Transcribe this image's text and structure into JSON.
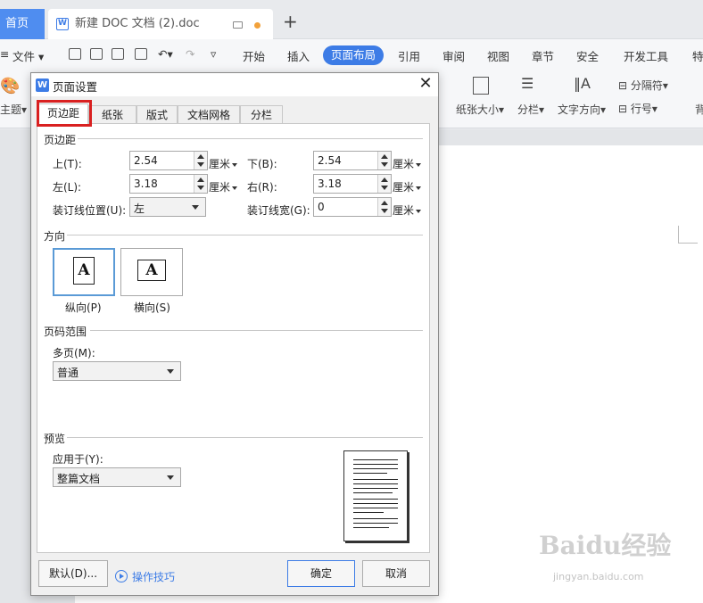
{
  "window": {
    "home_tab": "首页",
    "doc_tab": "新建 DOC 文档 (2).doc",
    "add_tab": "+"
  },
  "ribbon": {
    "file_menu": "文件",
    "tabs": [
      "开始",
      "插入",
      "页面布局",
      "引用",
      "审阅",
      "视图",
      "章节",
      "安全",
      "开发工具",
      "特"
    ],
    "active_tab": "页面布局",
    "theme_label": "主题",
    "paper_size": "纸张大小",
    "columns": "分栏",
    "text_direction": "文字方向",
    "separator": "分隔符",
    "line_number": "行号",
    "background": "背"
  },
  "dialog": {
    "title": "页面设置",
    "tabs": [
      "页边距",
      "纸张",
      "版式",
      "文档网格",
      "分栏"
    ],
    "active_tab": "页边距",
    "margins": {
      "group": "页边距",
      "top_label": "上(T):",
      "top_value": "2.54",
      "bottom_label": "下(B):",
      "bottom_value": "2.54",
      "left_label": "左(L):",
      "left_value": "3.18",
      "right_label": "右(R):",
      "right_value": "3.18",
      "gutter_pos_label": "装订线位置(U):",
      "gutter_pos_value": "左",
      "gutter_width_label": "装订线宽(G):",
      "gutter_width_value": "0",
      "unit": "厘米"
    },
    "orientation": {
      "group": "方向",
      "portrait": "纵向(P)",
      "landscape": "横向(S)",
      "glyph": "A",
      "selected": "portrait"
    },
    "pages": {
      "group": "页码范围",
      "multi_label": "多页(M):",
      "multi_value": "普通"
    },
    "preview": {
      "group": "预览",
      "apply_label": "应用于(Y):",
      "apply_value": "整篇文档"
    },
    "buttons": {
      "default": "默认(D)...",
      "tips": "操作技巧",
      "ok": "确定",
      "cancel": "取消"
    }
  },
  "watermark": {
    "brand": "Baidu经验",
    "url": "jingyan.baidu.com"
  },
  "colors": {
    "accent": "#3d7ce6",
    "highlight": "#d92020",
    "tab_modified_dot": "#f2a13a"
  }
}
